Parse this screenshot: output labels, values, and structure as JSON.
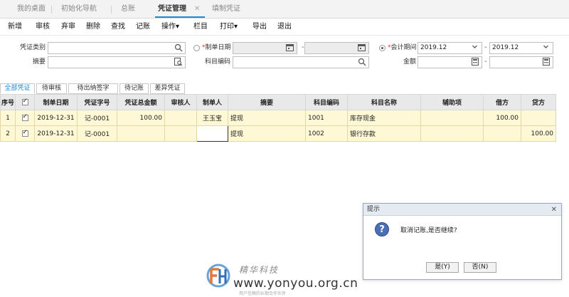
{
  "tabs": [
    {
      "label": "我的桌面"
    },
    {
      "label": "初始化导航"
    },
    {
      "label": "总账"
    },
    {
      "label": "凭证管理",
      "close": "✕"
    },
    {
      "label": "填制凭证"
    }
  ],
  "toolbar": [
    "新增",
    "审核",
    "弃审",
    "删除",
    "查找",
    "记账",
    "操作▾",
    "栏目",
    "打印▾",
    "导出",
    "退出"
  ],
  "form": {
    "voucher_type_label": "凭证类别",
    "voucher_type_value": "",
    "date_label": "制单日期",
    "date_start": "",
    "date_end": "",
    "period_label": "会计期间",
    "period_start": "2019.12",
    "period_end": "2019.12",
    "summary_label": "摘要",
    "summary_value": "",
    "account_code_label": "科目编码",
    "account_code_value": "",
    "amount_label": "金额",
    "amount_start": "",
    "amount_end": "",
    "required_mark": "*",
    "dash": "-"
  },
  "filter_tabs": [
    "全部凭证",
    "待审核",
    "待出纳签字",
    "待记账",
    "差异凭证"
  ],
  "grid": {
    "headers": [
      "序号",
      "",
      "制单日期",
      "凭证字号",
      "凭证总金额",
      "审核人",
      "制单人",
      "摘要",
      "科目编码",
      "科目名称",
      "辅助项",
      "借方",
      "贷方"
    ],
    "rows": [
      {
        "seq": "1",
        "checked": true,
        "date": "2019-12-31",
        "voucher_no": "记-0001",
        "total": "100.00",
        "auditor": "",
        "maker": "王玉宝",
        "summary": "提现",
        "code": "1001",
        "name": "库存现金",
        "aux": "",
        "debit": "100.00",
        "credit": ""
      },
      {
        "seq": "2",
        "checked": true,
        "date": "2019-12-31",
        "voucher_no": "记-0001",
        "total": "",
        "auditor": "",
        "maker": "",
        "summary": "提现",
        "code": "1002",
        "name": "银行存款",
        "aux": "",
        "debit": "",
        "credit": "100.00"
      }
    ]
  },
  "dialog": {
    "title": "提示",
    "close": "✕",
    "icon": "?",
    "message": "取消记账,是否继续?",
    "yes": "是(Y)",
    "no": "否(N)"
  },
  "watermark": {
    "cn": "精华科技",
    "url": "www.yonyou.org.cn",
    "sub": "用户信赖的长期合作伙伴"
  }
}
